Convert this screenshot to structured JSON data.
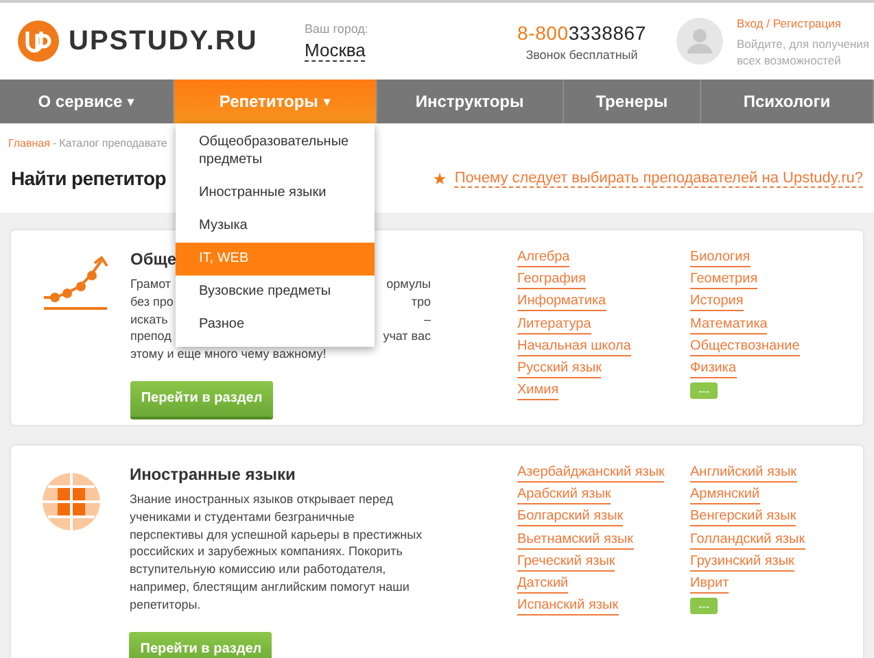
{
  "header": {
    "logo_text": "UPSTUDY.RU",
    "city_label": "Ваш город:",
    "city": "Москва",
    "phone_prefix": "8-800",
    "phone_number": "3338867",
    "phone_note": "Звонок бесплатный",
    "login_link": "Вход / Регистрация",
    "login_note": "Войдите, для получения всех возможностей"
  },
  "nav": [
    {
      "label": "О сервисе",
      "caret": "▾",
      "selected": false
    },
    {
      "label": "Репетиторы",
      "caret": "▾",
      "selected": true
    },
    {
      "label": "Инструкторы",
      "selected": false
    },
    {
      "label": "Тренеры",
      "selected": false
    },
    {
      "label": "Психологи",
      "selected": false
    }
  ],
  "dropdown": [
    {
      "label": "Общеобразовательные предметы",
      "selected": false
    },
    {
      "label": "Иностранные языки",
      "selected": false
    },
    {
      "label": "Музыка",
      "selected": false
    },
    {
      "label": "IT, WEB",
      "selected": true
    },
    {
      "label": "Вузовские предметы",
      "selected": false
    },
    {
      "label": "Разное",
      "selected": false
    }
  ],
  "breadcrumb": {
    "home": "Главная",
    "separator": "-",
    "current": "Каталог преподавате"
  },
  "heading": "Найти репетитор",
  "why_link": "Почему следует выбирать преподавателей на Upstudy.ru?",
  "categories": [
    {
      "kind": "chart",
      "title": "Обще",
      "description_lines": [
        {
          "left": "Грамот",
          "right": "ормулы"
        },
        {
          "left": "без про",
          "right": "тро"
        },
        {
          "left": "искать",
          "right": "–"
        },
        {
          "left": "препод",
          "right": "учат вас"
        },
        {
          "left": "этому и еще много чему важному!"
        }
      ],
      "links_left": [
        "Алгебра",
        "География",
        "Информатика",
        "Литература",
        "Начальная школа",
        "Русский язык",
        "Химия"
      ],
      "links_right": [
        "Биология",
        "Геометрия",
        "История",
        "Математика",
        "Обществознание",
        "Физика"
      ],
      "more": "---",
      "button": "Перейти в раздел"
    },
    {
      "kind": "globe",
      "title": "Иностранные языки",
      "description": "Знание иностранных языков открывает перед учениками и студентами безграничные перспективы для успешной карьеры в престижных российских и зарубежных компаниях. Покорить вступительную комиссию или работодателя, например, блестящим английским помогут наши репетиторы.",
      "links_left": [
        "Азербайджанский язык",
        "Арабский язык",
        "Болгарский язык",
        "Вьетнамский язык",
        "Греческий язык",
        "Датский",
        "Испанский язык"
      ],
      "links_right": [
        "Английский язык",
        "Армянский",
        "Венгерский язык",
        "Голландский язык",
        "Грузинский язык",
        "Иврит"
      ],
      "more": "---",
      "button": "Перейти в раздел"
    }
  ]
}
